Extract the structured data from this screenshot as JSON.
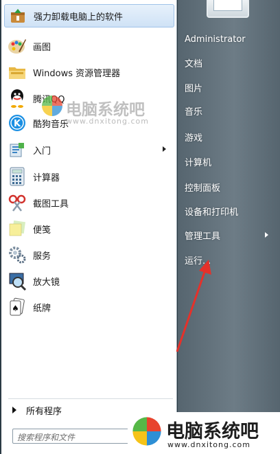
{
  "left_pane": {
    "programs": [
      {
        "label": "强力卸载电脑上的软件",
        "icon": "uninstaller-icon"
      },
      {
        "label": "画图",
        "icon": "paint-icon"
      },
      {
        "label": "Windows 资源管理器",
        "icon": "explorer-icon"
      },
      {
        "label": "腾讯QQ",
        "icon": "qq-icon"
      },
      {
        "label": "酷狗音乐",
        "icon": "kugou-icon"
      },
      {
        "label": "入门",
        "icon": "getting-started-icon"
      },
      {
        "label": "计算器",
        "icon": "calculator-icon"
      },
      {
        "label": "截图工具",
        "icon": "snipping-tool-icon"
      },
      {
        "label": "便笺",
        "icon": "sticky-notes-icon"
      },
      {
        "label": "服务",
        "icon": "services-icon"
      },
      {
        "label": "放大镜",
        "icon": "magnifier-icon"
      },
      {
        "label": "纸牌",
        "icon": "solitaire-icon"
      }
    ],
    "all_programs": "所有程序",
    "search_placeholder": "搜索程序和文件"
  },
  "right_pane": {
    "items": [
      {
        "label": "Administrator"
      },
      {
        "label": "文档"
      },
      {
        "label": "图片"
      },
      {
        "label": "音乐"
      },
      {
        "label": "游戏"
      },
      {
        "label": "计算机"
      },
      {
        "label": "控制面板"
      },
      {
        "label": "设备和打印机"
      },
      {
        "label": "管理工具"
      },
      {
        "label": "运行..."
      }
    ]
  },
  "watermark": {
    "title": "电脑系统吧",
    "url": "www.dnxitong.com",
    "colors": {
      "red": "#e8442e",
      "green": "#56b847",
      "blue": "#2d8fd5",
      "yellow": "#f5c318"
    }
  },
  "annotation": {
    "arrow_color": "#e5312a"
  },
  "colors": {
    "left_bg": "#ffffff",
    "right_bg": "#6d7c86",
    "highlight": "#cfe2f6"
  }
}
